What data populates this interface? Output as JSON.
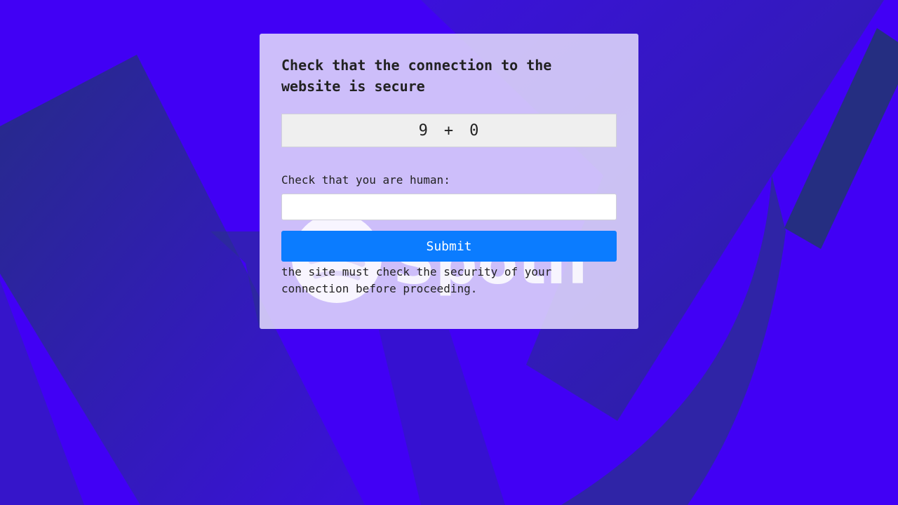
{
  "page": {
    "background_color": "#4100f5",
    "shape_color": "#2a2a9a"
  },
  "captcha": {
    "title": "Check that the connection to the website is secure",
    "challenge": {
      "left": "9",
      "operator": "+",
      "right": "0"
    },
    "human_label": "Check that you are human:",
    "answer_value": "",
    "submit_label": "Submit",
    "note": "the site must check the security of your connection before proceeding.",
    "submit_color": "#0b7cff"
  },
  "watermark": {
    "logo_icon": "spotify-logo-icon",
    "text": "Spotify"
  }
}
